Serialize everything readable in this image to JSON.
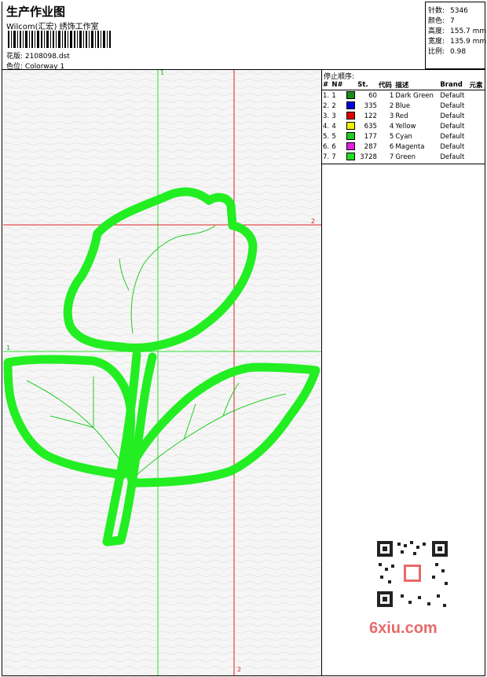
{
  "header": {
    "title": "生产作业图",
    "subtitle": "Wilcom(汇宏) 绣饰工作室",
    "design_file": "花版:  2108098.dst",
    "colorway": "色位:  Colorway 1"
  },
  "stats": [
    {
      "label": "针数:",
      "value": "5346"
    },
    {
      "label": "颜色:",
      "value": "7"
    },
    {
      "label": "高度:",
      "value": "155.7 mm"
    },
    {
      "label": "宽度:",
      "value": "135.9 mm"
    },
    {
      "label": "比例:",
      "value": "0.98"
    }
  ],
  "stop_sequence": {
    "label": "停止顺序:",
    "columns": [
      "#",
      "N#",
      "St.",
      "代码",
      "描述",
      "Brand",
      "元素"
    ],
    "rows": [
      {
        "idx": "1.",
        "n": "1",
        "color": "#1a8a1a",
        "st": "60",
        "code": "1",
        "desc": "Dark Green",
        "brand": "Default"
      },
      {
        "idx": "2.",
        "n": "2",
        "color": "#0000e0",
        "st": "335",
        "code": "2",
        "desc": "Blue",
        "brand": "Default"
      },
      {
        "idx": "3.",
        "n": "3",
        "color": "#e00000",
        "st": "122",
        "code": "3",
        "desc": "Red",
        "brand": "Default"
      },
      {
        "idx": "4.",
        "n": "4",
        "color": "#f0f000",
        "st": "635",
        "code": "4",
        "desc": "Yellow",
        "brand": "Default"
      },
      {
        "idx": "5.",
        "n": "5",
        "color": "#22cc22",
        "st": "177",
        "code": "5",
        "desc": "Cyan",
        "brand": "Default"
      },
      {
        "idx": "6.",
        "n": "6",
        "color": "#e020e0",
        "st": "287",
        "code": "6",
        "desc": "Magenta",
        "brand": "Default"
      },
      {
        "idx": "7.",
        "n": "7",
        "color": "#22dd22",
        "st": "3728",
        "code": "7",
        "desc": "Green",
        "brand": "Default"
      }
    ]
  },
  "guides": {
    "vertical_green": "1",
    "horizontal_red": "2",
    "horizontal_green": "1",
    "vertical_red": "2"
  },
  "watermark": "6xiu.com",
  "colors": {
    "stitch": "#22ee22",
    "guide_green": "#33dd33",
    "guide_red": "#dd2222"
  }
}
